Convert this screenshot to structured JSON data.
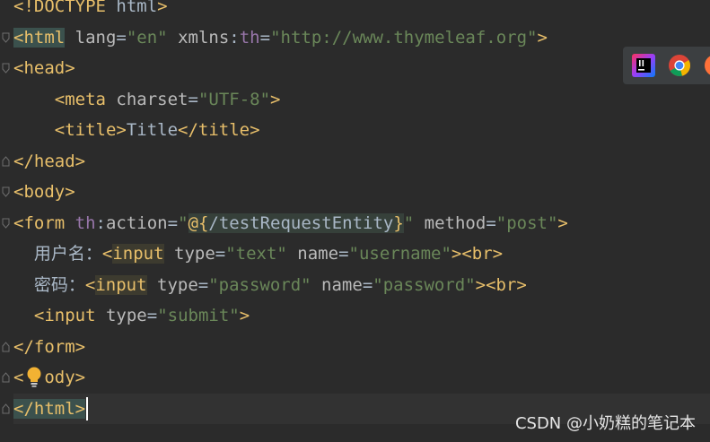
{
  "editor": {
    "lines": [
      {
        "segments": [
          {
            "cls": "t",
            "text": "<!DOCTYPE "
          },
          {
            "cls": "tx",
            "text": "html"
          },
          {
            "cls": "t",
            "text": ">"
          }
        ]
      },
      {
        "segments": [
          {
            "cls": "t hl-tag",
            "text": "<html"
          },
          {
            "cls": "an",
            "text": " lang"
          },
          {
            "cls": "tx",
            "text": "="
          },
          {
            "cls": "av",
            "text": "\"en\""
          },
          {
            "cls": "an",
            "text": " xmlns"
          },
          {
            "cls": "tx",
            "text": ":"
          },
          {
            "cls": "ns",
            "text": "th"
          },
          {
            "cls": "tx",
            "text": "="
          },
          {
            "cls": "av",
            "text": "\"http://www.thymeleaf.org\""
          },
          {
            "cls": "t",
            "text": ">"
          }
        ]
      },
      {
        "segments": [
          {
            "cls": "t",
            "text": "<head>"
          }
        ]
      },
      {
        "segments": [
          {
            "cls": "tx",
            "text": "    "
          },
          {
            "cls": "t",
            "text": "<meta"
          },
          {
            "cls": "an",
            "text": " charset"
          },
          {
            "cls": "tx",
            "text": "="
          },
          {
            "cls": "av",
            "text": "\"UTF-8\""
          },
          {
            "cls": "t",
            "text": ">"
          }
        ]
      },
      {
        "segments": [
          {
            "cls": "tx",
            "text": "    "
          },
          {
            "cls": "t",
            "text": "<title>"
          },
          {
            "cls": "tx",
            "text": "Title"
          },
          {
            "cls": "t",
            "text": "</title>"
          }
        ]
      },
      {
        "segments": [
          {
            "cls": "t",
            "text": "</head>"
          }
        ]
      },
      {
        "segments": [
          {
            "cls": "t",
            "text": "<body>"
          }
        ]
      },
      {
        "segments": [
          {
            "cls": "t",
            "text": "<form"
          },
          {
            "cls": "ns",
            "text": " th"
          },
          {
            "cls": "tx",
            "text": ":"
          },
          {
            "cls": "an",
            "text": "action"
          },
          {
            "cls": "tx",
            "text": "="
          },
          {
            "cls": "av",
            "text": "\""
          },
          {
            "cls": "t hl-expr",
            "text": "@{"
          },
          {
            "cls": "tx hl-expr",
            "text": "/testRequestEntity"
          },
          {
            "cls": "t hl-expr",
            "text": "}"
          },
          {
            "cls": "av",
            "text": "\""
          },
          {
            "cls": "an",
            "text": " method"
          },
          {
            "cls": "tx",
            "text": "="
          },
          {
            "cls": "av",
            "text": "\"post\""
          },
          {
            "cls": "t",
            "text": ">"
          }
        ]
      },
      {
        "segments": [
          {
            "cls": "tx",
            "text": "  "
          },
          {
            "cls": "tx cjk",
            "text": "用户名："
          },
          {
            "cls": "t",
            "text": "<"
          },
          {
            "cls": "t hl-word",
            "text": "input"
          },
          {
            "cls": "an",
            "text": " type"
          },
          {
            "cls": "tx",
            "text": "="
          },
          {
            "cls": "av",
            "text": "\"text\""
          },
          {
            "cls": "an",
            "text": " name"
          },
          {
            "cls": "tx",
            "text": "="
          },
          {
            "cls": "av",
            "text": "\"username\""
          },
          {
            "cls": "t",
            "text": "><br>"
          }
        ]
      },
      {
        "segments": [
          {
            "cls": "tx",
            "text": "  "
          },
          {
            "cls": "tx cjk",
            "text": "密码："
          },
          {
            "cls": "t",
            "text": "<"
          },
          {
            "cls": "t hl-word",
            "text": "input"
          },
          {
            "cls": "an",
            "text": " type"
          },
          {
            "cls": "tx",
            "text": "="
          },
          {
            "cls": "av",
            "text": "\"password\""
          },
          {
            "cls": "an",
            "text": " name"
          },
          {
            "cls": "tx",
            "text": "="
          },
          {
            "cls": "av",
            "text": "\"password\""
          },
          {
            "cls": "t",
            "text": "><br>"
          }
        ]
      },
      {
        "segments": [
          {
            "cls": "tx",
            "text": "  "
          },
          {
            "cls": "t",
            "text": "<input"
          },
          {
            "cls": "an",
            "text": " type"
          },
          {
            "cls": "tx",
            "text": "="
          },
          {
            "cls": "av",
            "text": "\"submit\""
          },
          {
            "cls": "t",
            "text": ">"
          }
        ]
      },
      {
        "segments": [
          {
            "cls": "t",
            "text": "</form>"
          }
        ]
      },
      {
        "segments": [
          {
            "cls": "t",
            "text": "<"
          },
          {
            "cls": "tx",
            "text": "  "
          },
          {
            "cls": "t",
            "text": "ody>"
          }
        ]
      },
      {
        "segments": [
          {
            "cls": "t hl-cur",
            "text": "</html>"
          }
        ]
      }
    ]
  },
  "browser_bar": {
    "icons": [
      "intellij-icon",
      "chrome-icon",
      "firefox-icon"
    ]
  },
  "watermark": {
    "text": "CSDN @小奶糕的笔记本"
  },
  "colors": {
    "background": "#2b2b2b",
    "tag": "#e8bf6a",
    "attribute_name": "#bababa",
    "attribute_value": "#6a8759",
    "namespace": "#9876aa",
    "text": "#a9b7c6"
  }
}
